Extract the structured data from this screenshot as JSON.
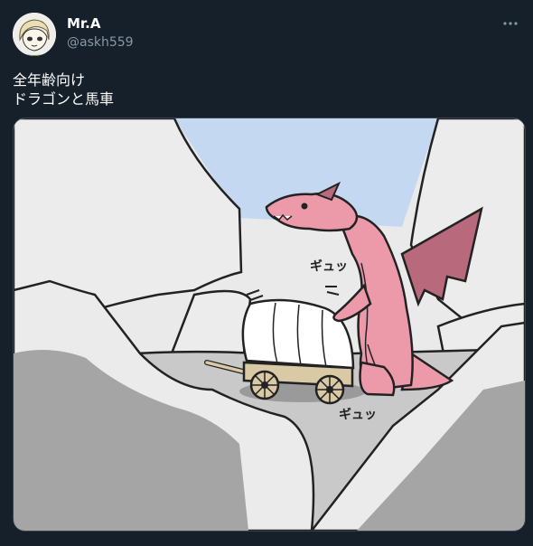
{
  "author": {
    "display_name": "Mr.A",
    "handle": "@askh559"
  },
  "tweet": {
    "text": "全年齢向け\nドラゴンと馬車"
  },
  "media": {
    "sfx_upper": "ギュッ",
    "sfx_lower": "ギュッ"
  },
  "icons": {
    "more": "more-horizontal-icon"
  },
  "colors": {
    "background": "#15202b",
    "handle": "#8899a6",
    "dragon": "#ec9aaa",
    "sky": "#c4d8f2"
  }
}
